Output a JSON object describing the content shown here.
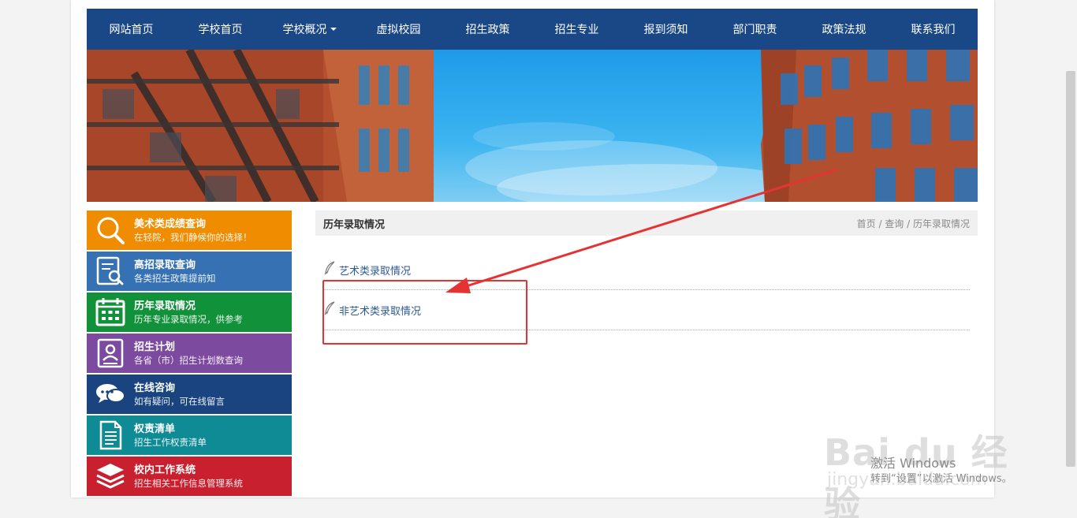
{
  "nav": {
    "items": [
      {
        "label": "网站首页"
      },
      {
        "label": "学校首页"
      },
      {
        "label": "学校概况",
        "dropdown": true
      },
      {
        "label": "虚拟校园"
      },
      {
        "label": "招生政策"
      },
      {
        "label": "招生专业"
      },
      {
        "label": "报到须知"
      },
      {
        "label": "部门职责"
      },
      {
        "label": "政策法规"
      },
      {
        "label": "联系我们"
      }
    ]
  },
  "sidebar": {
    "items": [
      {
        "title": "美术类成绩查询",
        "sub": "在轻院，我们静候你的选择！",
        "color": "#f08c00",
        "icon": "search-icon"
      },
      {
        "title": "高招录取查询",
        "sub": "各类招生政策提前知",
        "color": "#3671b3",
        "icon": "document-search-icon"
      },
      {
        "title": "历年录取情况",
        "sub": "历年专业录取情况，供参考",
        "color": "#119139",
        "icon": "calendar-icon"
      },
      {
        "title": "招生计划",
        "sub": "各省（市）招生计划数查询",
        "color": "#7c4a9e",
        "icon": "id-card-icon"
      },
      {
        "title": "在线咨询",
        "sub": "如有疑问，可在线留言",
        "color": "#1a4480",
        "icon": "chat-icon"
      },
      {
        "title": "权责清单",
        "sub": "招生工作权责清单",
        "color": "#0f8b96",
        "icon": "list-document-icon"
      },
      {
        "title": "校内工作系统",
        "sub": "招生相关工作信息管理系统",
        "color": "#c8202f",
        "icon": "layers-icon"
      }
    ]
  },
  "content": {
    "title": "历年录取情况",
    "breadcrumb": [
      "首页",
      "查询",
      "历年录取情况"
    ],
    "breadcrumb_sep": " / ",
    "items": [
      {
        "label": "艺术类录取情况"
      },
      {
        "label": "非艺术类录取情况"
      }
    ]
  },
  "watermark": {
    "logo": "Bai du 经验",
    "url": "jingyan.baidu.com"
  },
  "os_notice": {
    "line1": "激活 Windows",
    "line2": "转到“设置”以激活 Windows。"
  },
  "colors": {
    "nav_bg": "#1a4785",
    "annotation": "#e53333"
  }
}
